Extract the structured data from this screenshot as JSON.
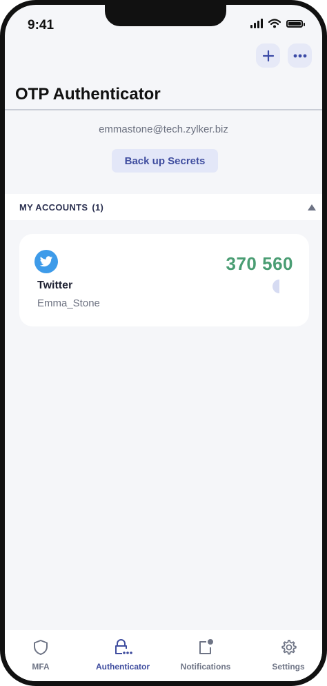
{
  "status_bar": {
    "time": "9:41"
  },
  "header": {
    "title": "OTP Authenticator",
    "add_icon": "plus-icon",
    "more_icon": "more-horizontal-icon"
  },
  "account_owner": {
    "email": "emmastone@tech.zylker.biz",
    "backup_label": "Back up Secrets"
  },
  "accounts_section": {
    "label": "MY ACCOUNTS",
    "count": "(1)",
    "items": [
      {
        "service": "Twitter",
        "username": "Emma_Stone",
        "otp": "370 560",
        "icon": "twitter-bird-icon",
        "timer_remaining": 0.5
      }
    ]
  },
  "tabbar": {
    "tabs": [
      {
        "label": "MFA",
        "icon": "shield-icon",
        "active": false
      },
      {
        "label": "Authenticator",
        "icon": "lock-dots-icon",
        "active": true
      },
      {
        "label": "Notifications",
        "icon": "notification-icon",
        "active": false
      },
      {
        "label": "Settings",
        "icon": "gear-icon",
        "active": false
      }
    ]
  },
  "colors": {
    "accent": "#3f4d9f",
    "otp": "#4a9d73",
    "twitter": "#3e9be9"
  }
}
